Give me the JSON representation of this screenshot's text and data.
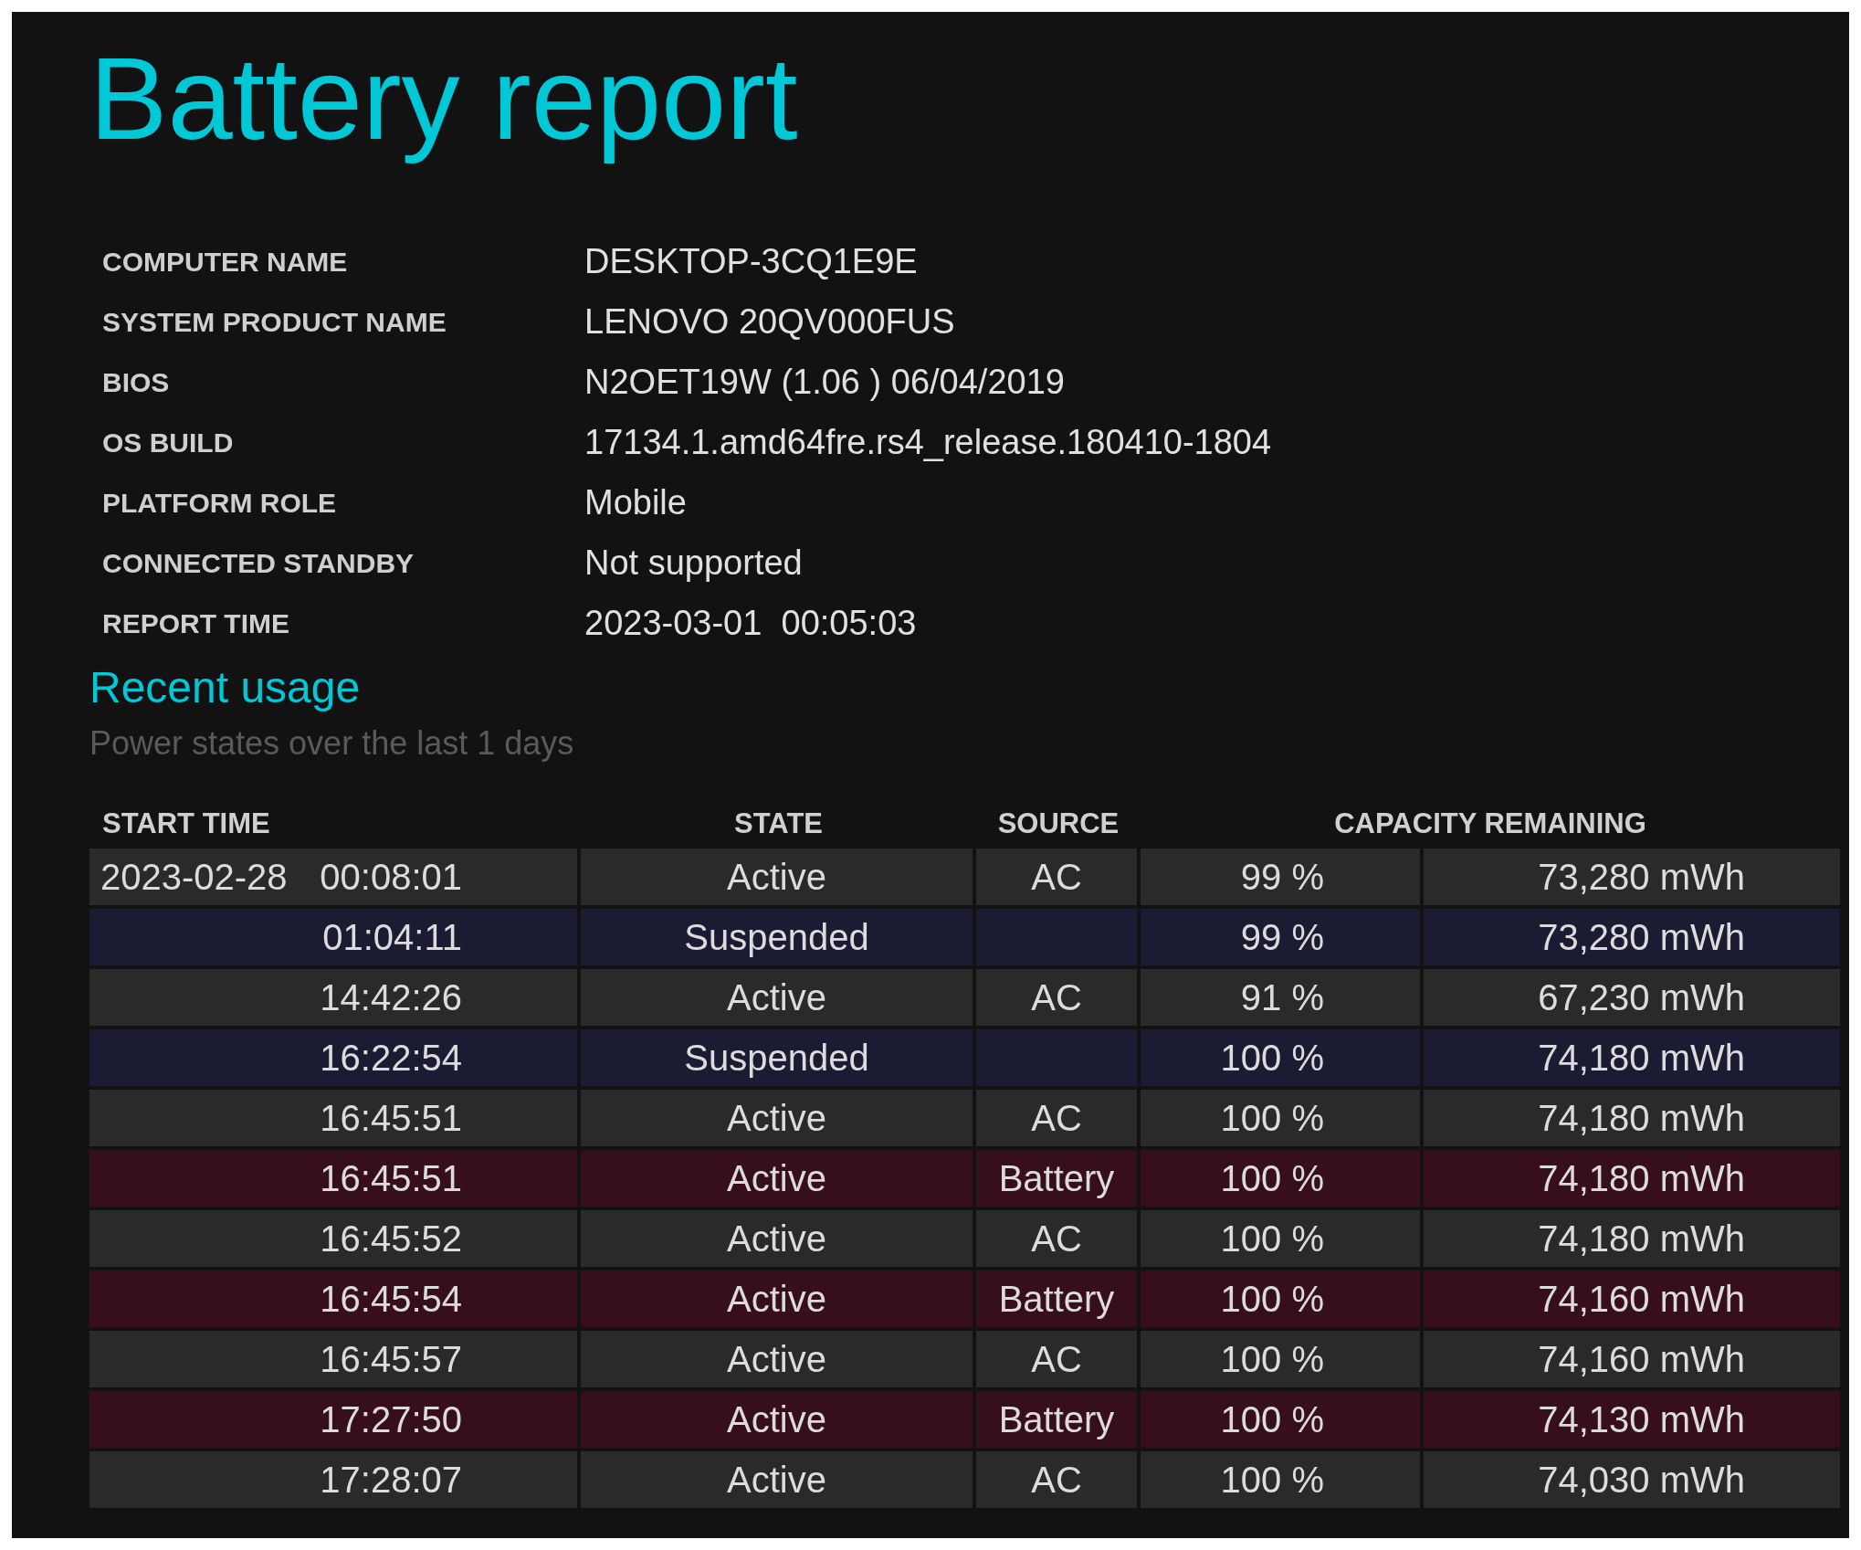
{
  "title": "Battery report",
  "info": [
    {
      "label": "COMPUTER NAME",
      "value": "DESKTOP-3CQ1E9E"
    },
    {
      "label": "SYSTEM PRODUCT NAME",
      "value": "LENOVO 20QV000FUS"
    },
    {
      "label": "BIOS",
      "value": "N2OET19W (1.06 ) 06/04/2019"
    },
    {
      "label": "OS BUILD",
      "value": "17134.1.amd64fre.rs4_release.180410-1804"
    },
    {
      "label": "PLATFORM ROLE",
      "value": "Mobile"
    },
    {
      "label": "CONNECTED STANDBY",
      "value": "Not supported"
    },
    {
      "label": "REPORT TIME",
      "value": "2023-03-01  00:05:03"
    }
  ],
  "section": {
    "title": "Recent usage",
    "subtitle": "Power states over the last 1 days"
  },
  "table": {
    "columns": [
      "START TIME",
      "STATE",
      "SOURCE",
      "CAPACITY REMAINING"
    ],
    "rows": [
      {
        "kind": "ac",
        "date": "2023-02-28",
        "time": "00:08:01",
        "state": "Active",
        "source": "AC",
        "percent": "99 %",
        "energy": "73,280 mWh"
      },
      {
        "kind": "suspended",
        "time": "01:04:11",
        "state": "Suspended",
        "percent": "99 %",
        "energy": "73,280 mWh"
      },
      {
        "kind": "ac",
        "time": "14:42:26",
        "state": "Active",
        "source": "AC",
        "percent": "91 %",
        "energy": "67,230 mWh"
      },
      {
        "kind": "suspended",
        "time": "16:22:54",
        "state": "Suspended",
        "percent": "100 %",
        "energy": "74,180 mWh"
      },
      {
        "kind": "ac",
        "time": "16:45:51",
        "state": "Active",
        "source": "AC",
        "percent": "100 %",
        "energy": "74,180 mWh"
      },
      {
        "kind": "battery",
        "time": "16:45:51",
        "state": "Active",
        "source": "Battery",
        "percent": "100 %",
        "energy": "74,180 mWh"
      },
      {
        "kind": "ac",
        "time": "16:45:52",
        "state": "Active",
        "source": "AC",
        "percent": "100 %",
        "energy": "74,180 mWh"
      },
      {
        "kind": "battery",
        "time": "16:45:54",
        "state": "Active",
        "source": "Battery",
        "percent": "100 %",
        "energy": "74,160 mWh"
      },
      {
        "kind": "ac",
        "time": "16:45:57",
        "state": "Active",
        "source": "AC",
        "percent": "100 %",
        "energy": "74,160 mWh"
      },
      {
        "kind": "battery",
        "time": "17:27:50",
        "state": "Active",
        "source": "Battery",
        "percent": "100 %",
        "energy": "74,130 mWh"
      },
      {
        "kind": "ac",
        "time": "17:28:07",
        "state": "Active",
        "source": "AC",
        "percent": "100 %",
        "energy": "74,030 mWh"
      }
    ]
  }
}
